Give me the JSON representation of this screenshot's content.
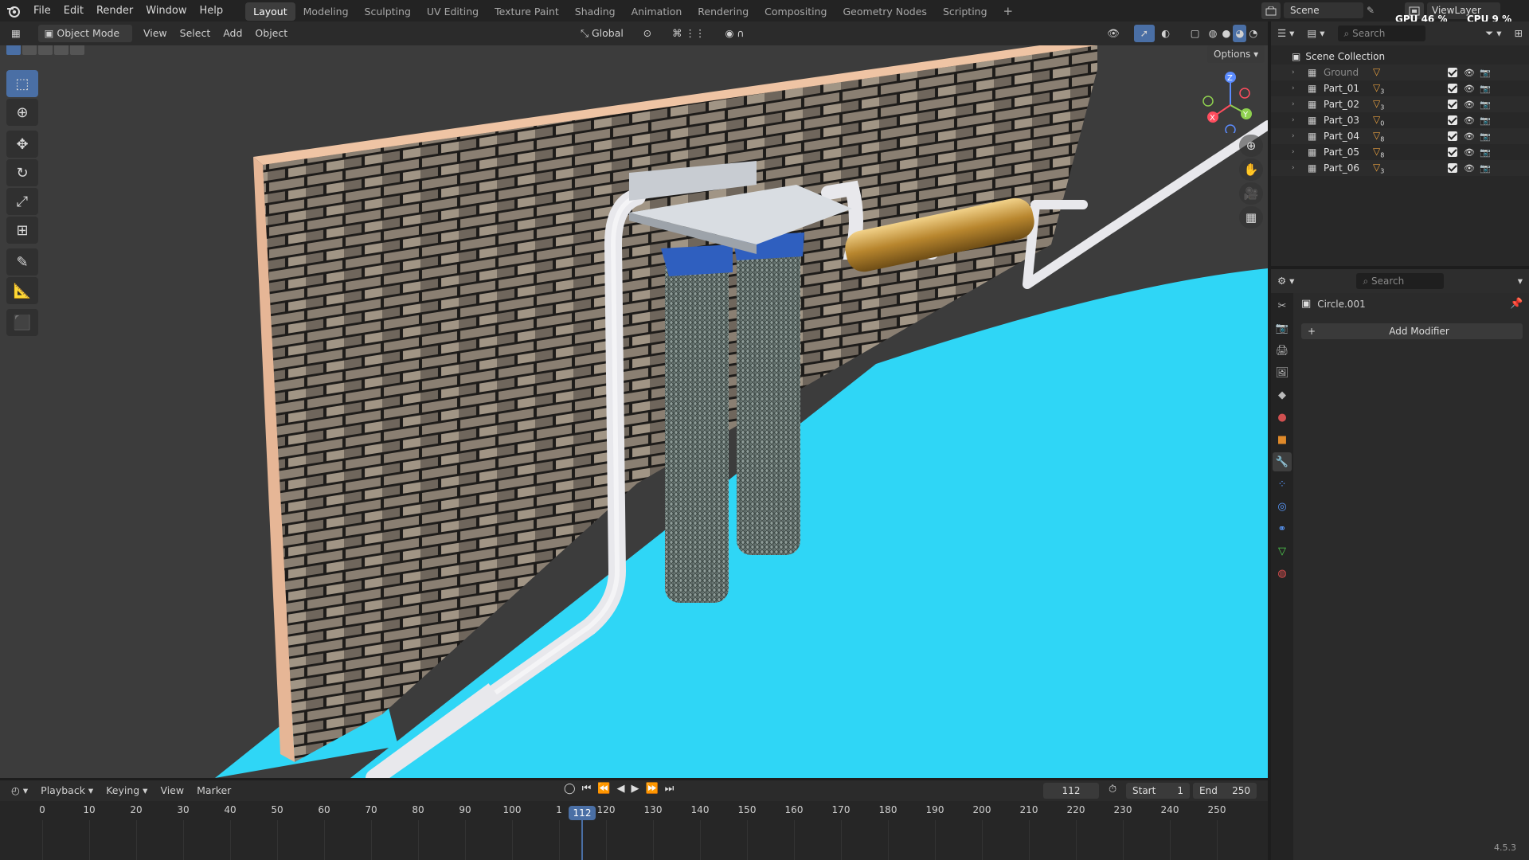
{
  "app": {
    "menu": [
      "File",
      "Edit",
      "Render",
      "Window",
      "Help"
    ],
    "workspaces": [
      "Layout",
      "Modeling",
      "Sculpting",
      "UV Editing",
      "Texture Paint",
      "Shading",
      "Animation",
      "Rendering",
      "Compositing",
      "Geometry Nodes",
      "Scripting"
    ],
    "active_workspace": "Layout",
    "add_workspace": "+",
    "scene_name": "Scene",
    "view_layer": "ViewLayer",
    "gpu_label": "GPU",
    "gpu_value": "46 %",
    "cpu_label": "CPU",
    "cpu_value": "9 %"
  },
  "viewport_header": {
    "mode": "Object Mode",
    "menus": [
      "View",
      "Select",
      "Add",
      "Object"
    ],
    "orientation": "Global",
    "options": "Options"
  },
  "gizmo": {
    "x": "X",
    "y": "Y",
    "z": "Z"
  },
  "outliner": {
    "search_placeholder": "Search",
    "root": "Scene Collection",
    "items": [
      {
        "name": "Ground",
        "count": "",
        "dim": true
      },
      {
        "name": "Part_01",
        "count": "3",
        "dim": false
      },
      {
        "name": "Part_02",
        "count": "3",
        "dim": false
      },
      {
        "name": "Part_03",
        "count": "0",
        "dim": false
      },
      {
        "name": "Part_04",
        "count": "8",
        "dim": false
      },
      {
        "name": "Part_05",
        "count": "8",
        "dim": false
      },
      {
        "name": "Part_06",
        "count": "3",
        "dim": false
      }
    ]
  },
  "properties": {
    "search_placeholder": "Search",
    "object_name": "Circle.001",
    "add_modifier": "Add Modifier",
    "add_icon": "+"
  },
  "timeline": {
    "menus": [
      "Playback",
      "Keying",
      "View",
      "Marker"
    ],
    "current_frame": "112",
    "start_label": "Start",
    "start_value": "1",
    "end_label": "End",
    "end_value": "250",
    "ticks": [
      "0",
      "10",
      "20",
      "30",
      "40",
      "50",
      "60",
      "70",
      "80",
      "90",
      "100",
      "1",
      "120",
      "130",
      "140",
      "150",
      "160",
      "170",
      "180",
      "190",
      "200",
      "210",
      "220",
      "230",
      "240",
      "250"
    ],
    "playhead_label": "112"
  },
  "version": "4.5.3",
  "colors": {
    "accent": "#4a6fa5",
    "ground": "#3ed8f5",
    "brick": "#7a6f64",
    "mortar": "#efc4a4"
  }
}
